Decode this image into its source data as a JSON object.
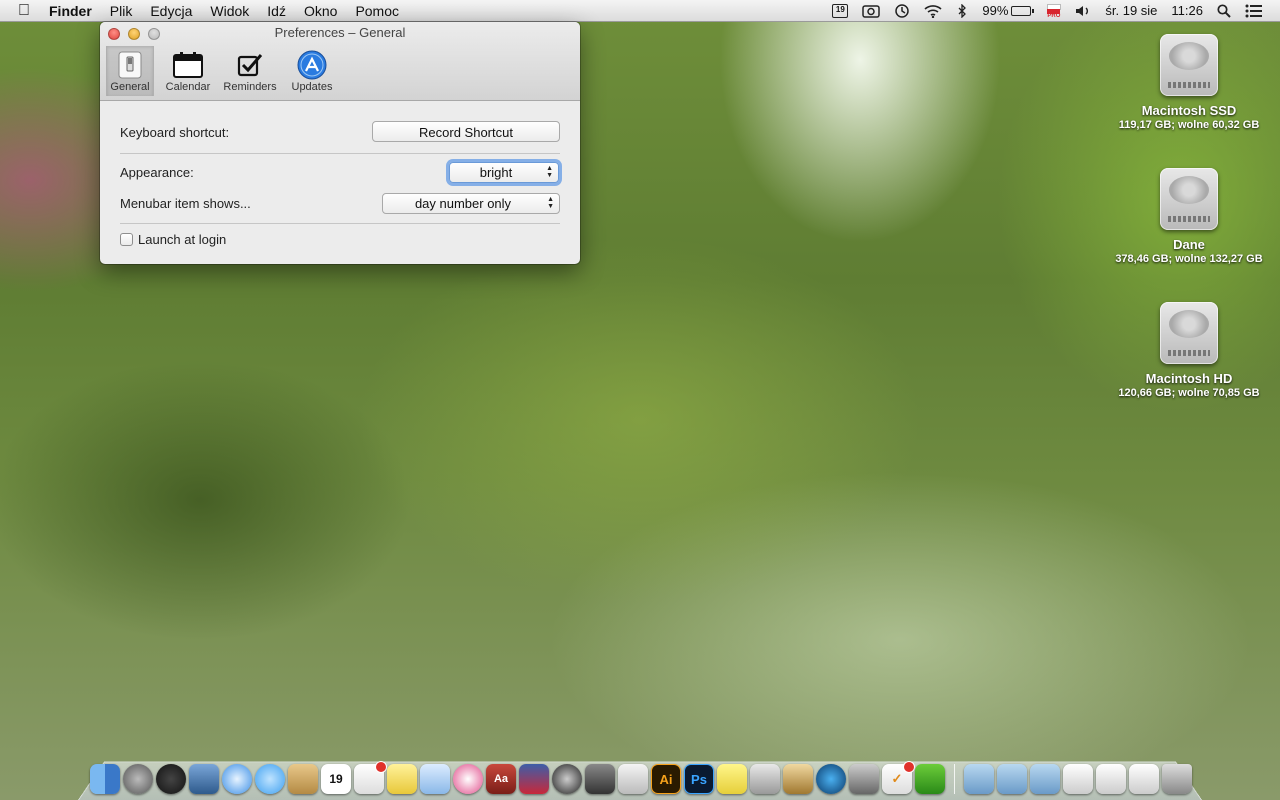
{
  "menubar": {
    "app_name": "Finder",
    "menus": [
      "Plik",
      "Edycja",
      "Widok",
      "Idź",
      "Okno",
      "Pomoc"
    ],
    "calendar_day": "19",
    "battery": "99%",
    "flag_label": "PRO",
    "date": "śr. 19 sie",
    "time": "11:26"
  },
  "window": {
    "title": "Preferences – General",
    "tabs": [
      {
        "label": "General"
      },
      {
        "label": "Calendar"
      },
      {
        "label": "Reminders"
      },
      {
        "label": "Updates"
      }
    ],
    "keyboard_shortcut_label": "Keyboard shortcut:",
    "record_shortcut_button": "Record Shortcut",
    "appearance_label": "Appearance:",
    "appearance_value": "bright",
    "menubar_item_label": "Menubar item shows...",
    "menubar_item_value": "day number only",
    "launch_at_login_label": "Launch at login",
    "launch_at_login_checked": false
  },
  "desktop": {
    "disks": [
      {
        "name": "Macintosh SSD",
        "info": "119,17 GB; wolne 60,32 GB"
      },
      {
        "name": "Dane",
        "info": "378,46 GB; wolne 132,27 GB"
      },
      {
        "name": "Macintosh HD",
        "info": "120,66 GB; wolne 70,85 GB"
      }
    ]
  },
  "dock": {
    "calendar_day": "19",
    "illustrator_label": "Ai",
    "photoshop_label": "Ps",
    "dictionary_label": "Aa"
  },
  "colors": {
    "menubar_bg": "#e6e6e6",
    "window_bg": "#ececec",
    "focus_ring": "#5a96e6",
    "close": "#e0443e",
    "minimize": "#dea123",
    "zoom": "#b8b8b8"
  }
}
